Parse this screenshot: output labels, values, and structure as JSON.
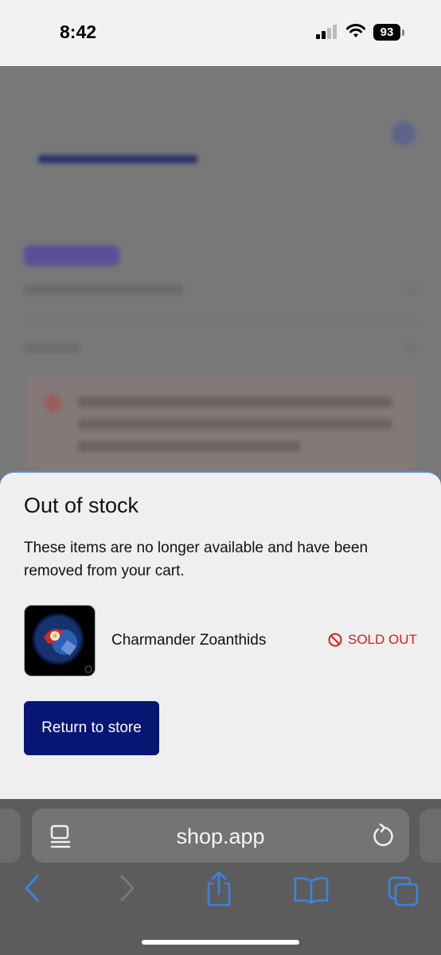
{
  "status_bar": {
    "time": "8:42",
    "battery": "93"
  },
  "sheet": {
    "title": "Out of stock",
    "message": "These items are no longer available and have been removed from your cart.",
    "items": [
      {
        "name": "Charmander Zoanthids",
        "status": "SOLD OUT"
      }
    ],
    "return_label": "Return to store"
  },
  "browser": {
    "url": "shop.app"
  },
  "colors": {
    "primary_button": "#071573",
    "sold_out": "#d22020",
    "safari_accent": "#3b82e6"
  }
}
